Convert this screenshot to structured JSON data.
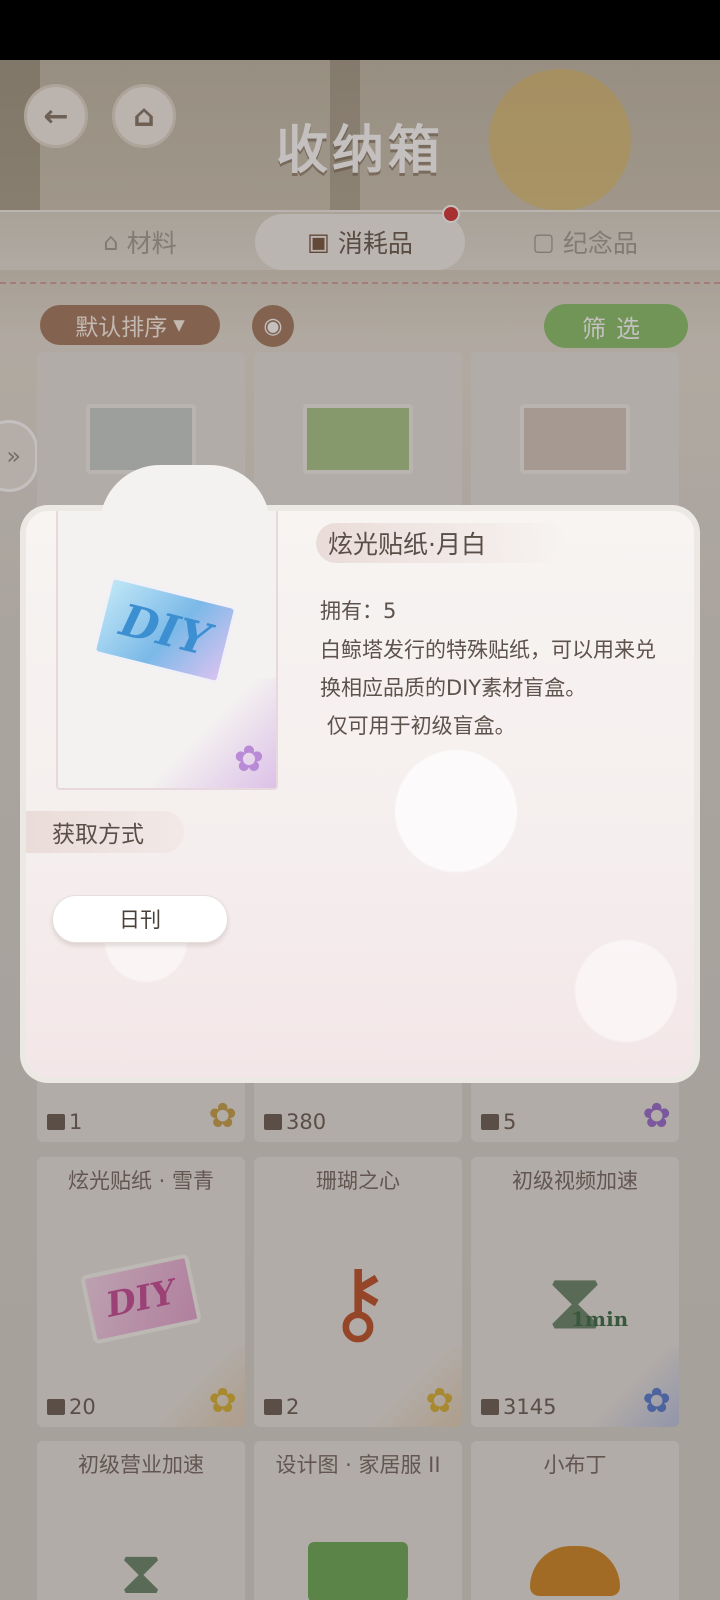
{
  "header": {
    "title": "收纳箱"
  },
  "tabs": [
    {
      "label": "材料",
      "icon": "basket-icon"
    },
    {
      "label": "消耗品",
      "icon": "box-icon",
      "active": true,
      "has_notification": true
    },
    {
      "label": "纪念品",
      "icon": "frame-icon"
    }
  ],
  "toolbar": {
    "sort_label": "默认排序",
    "filter_label": "筛选"
  },
  "grid": {
    "row1_counts": [
      "1",
      "380",
      "5"
    ],
    "row2": [
      {
        "name": "炫光贴纸 · 雪青",
        "count": "20"
      },
      {
        "name": "珊瑚之心",
        "count": "2"
      },
      {
        "name": "初级视频加速",
        "count": "3145"
      }
    ],
    "row3": [
      {
        "name": "初级营业加速"
      },
      {
        "name": "设计图 · 家居服 II"
      },
      {
        "name": "小布丁"
      }
    ],
    "hourglass_badge": "1min"
  },
  "popup": {
    "item_name": "炫光贴纸·月白",
    "art_text": "DIY",
    "owned": "拥有：5",
    "description": "白鲸塔发行的特殊贴纸，可以用来兑换相应品质的DIY素材盲盒。\n 仅可用于初级盲盒。",
    "acquire_label": "获取方式",
    "source_button": "日刊"
  },
  "colors": {
    "filter_button": "#8cc46e",
    "sort_button": "#a77e66",
    "notification_dot": "#d93a3a"
  }
}
